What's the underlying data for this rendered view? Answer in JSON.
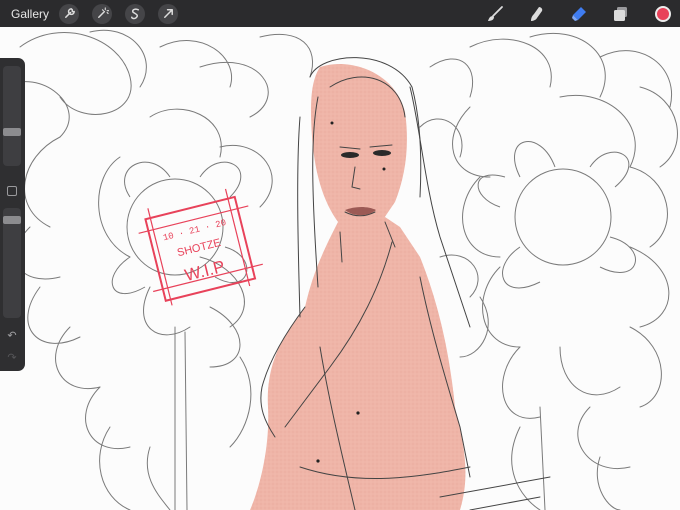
{
  "topbar": {
    "gallery_label": "Gallery",
    "left_tools": [
      "wrench-icon",
      "magic-wand-icon",
      "selection-icon",
      "transform-arrow-icon"
    ],
    "right_tools": [
      "brush-icon",
      "smudge-icon",
      "eraser-icon",
      "layers-icon"
    ],
    "active_tool": "eraser-icon",
    "current_color": "#e8425a"
  },
  "sidebar": {
    "brush_size_level": 0.6,
    "opacity_level": 0.9,
    "controls": [
      "brush-size-slider",
      "modify-button",
      "opacity-slider",
      "undo-icon",
      "redo-icon"
    ]
  },
  "canvas": {
    "stamp": {
      "line1": "10 · 21 · 20",
      "line2": "SHOTZE",
      "line3": "W.I.P"
    },
    "colors": {
      "skin": "#efb5a8",
      "line": "#4a4a4a",
      "stamp": "#e8425a",
      "accent": "#3f7cf0"
    }
  }
}
